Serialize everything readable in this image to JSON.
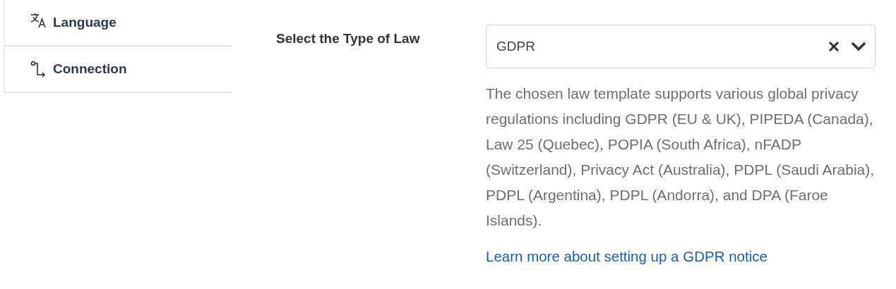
{
  "sidebar": {
    "items": [
      {
        "label": "Language"
      },
      {
        "label": "Connection"
      }
    ]
  },
  "field": {
    "label": "Select the Type of Law",
    "value": "GDPR",
    "help": "The chosen law template supports various global privacy regulations including GDPR (EU & UK), PIPEDA (Canada), Law 25 (Quebec), POPIA (South Africa), nFADP (Switzerland), Privacy Act (Australia), PDPL (Saudi Arabia), PDPL (Argentina), PDPL (Andorra), and DPA (Faroe Islands).",
    "link": "Learn more about setting up a GDPR notice"
  }
}
